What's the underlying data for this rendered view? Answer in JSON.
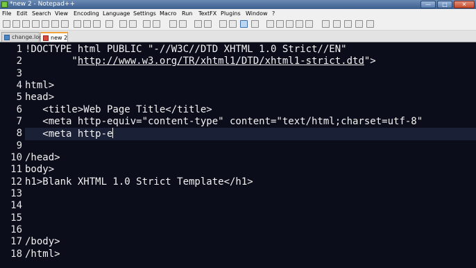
{
  "window": {
    "title": "*new  2 - Notepad++",
    "buttons": {
      "minimize": "—",
      "maximize": "□",
      "close": "✕"
    }
  },
  "menu": [
    "File",
    "Edit",
    "Search",
    "View",
    "Encoding",
    "Language",
    "Settings",
    "Macro",
    "Run",
    "TextFX",
    "Plugins",
    "Window",
    "?"
  ],
  "tabs": [
    {
      "label": "change.log",
      "icon": "file-saved-icon",
      "active": false
    },
    {
      "label": "new  2",
      "icon": "file-unsaved-icon",
      "active": true
    }
  ],
  "editor": {
    "current_line": 8,
    "lines": [
      {
        "n": "1",
        "text": "!DOCTYPE html PUBLIC \"-//W3C//DTD XHTML 1.0 Strict//EN\""
      },
      {
        "n": "2",
        "pre": "        \"",
        "link": "http://www.w3.org/TR/xhtml1/DTD/xhtml1-strict.dtd",
        "post": "\">"
      },
      {
        "n": "3",
        "text": ""
      },
      {
        "n": "4",
        "text": "html>"
      },
      {
        "n": "5",
        "text": "head>"
      },
      {
        "n": "6",
        "text": "   <title>Web Page Title</title>"
      },
      {
        "n": "7",
        "text": "   <meta http-equiv=\"content-type\" content=\"text/html;charset=utf-8\""
      },
      {
        "n": "8",
        "text": "   <meta http-e"
      },
      {
        "n": "9",
        "text": ""
      },
      {
        "n": "10",
        "text": "/head>"
      },
      {
        "n": "11",
        "text": "body>"
      },
      {
        "n": "12",
        "text": "h1>Blank XHTML 1.0 Strict Template</h1>"
      },
      {
        "n": "13",
        "text": ""
      },
      {
        "n": "14",
        "text": ""
      },
      {
        "n": "15",
        "text": ""
      },
      {
        "n": "16",
        "text": ""
      },
      {
        "n": "17",
        "text": "/body>"
      },
      {
        "n": "18",
        "text": "/html>"
      }
    ]
  },
  "colors": {
    "editor_bg": "#0b0e1a",
    "text": "#f2f2f2",
    "active_tab_accent": "#f2a43a"
  }
}
